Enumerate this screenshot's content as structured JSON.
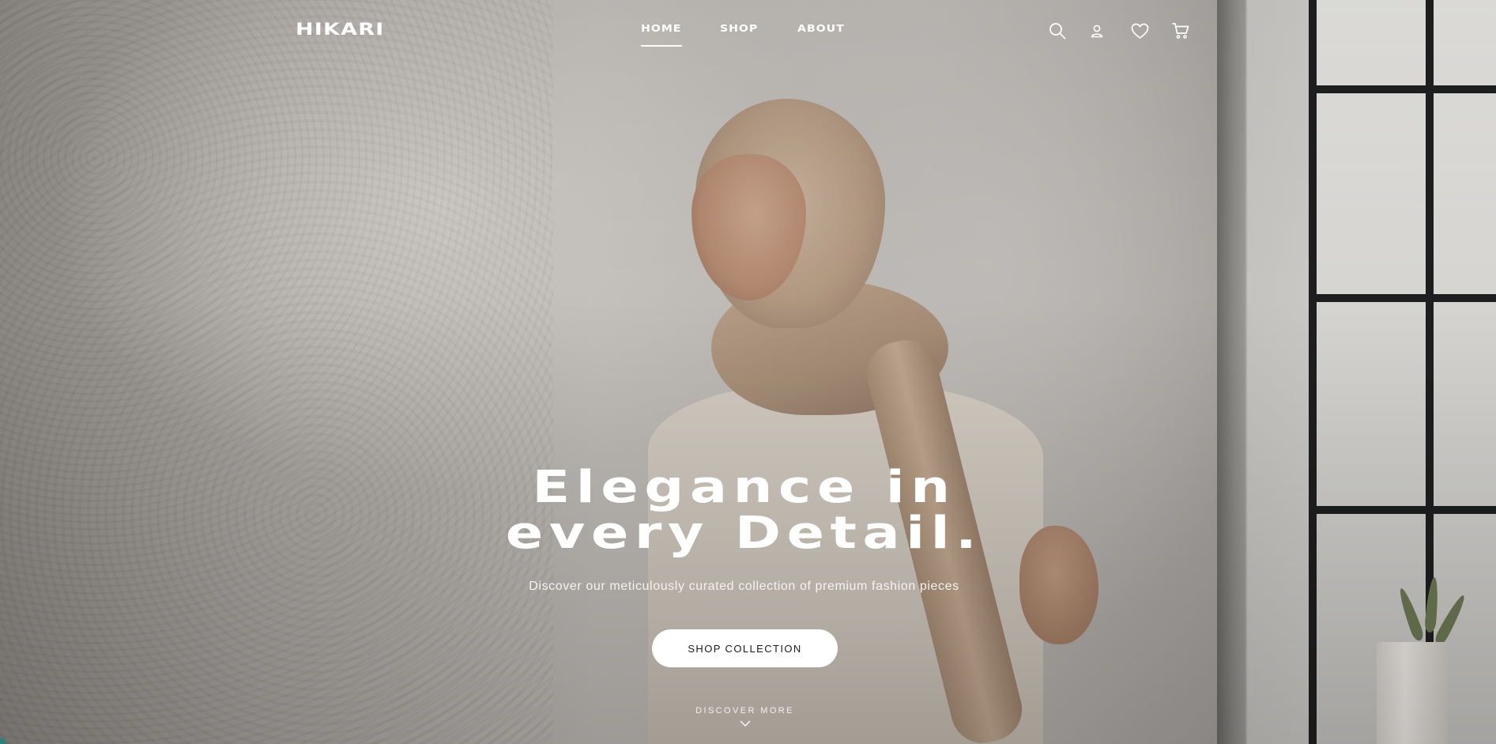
{
  "brand": {
    "logo": "HIKARI"
  },
  "nav": {
    "items": [
      {
        "label": "HOME",
        "active": true
      },
      {
        "label": "SHOP",
        "active": false
      },
      {
        "label": "ABOUT",
        "active": false
      }
    ]
  },
  "header_icons": [
    "search-icon",
    "user-icon",
    "heart-icon",
    "cart-icon"
  ],
  "hero": {
    "headline_line1": "Elegance in",
    "headline_line2": "every Detail.",
    "subtitle": "Discover our meticulously curated collection of premium fashion pieces",
    "cta_label": "SHOP COLLECTION",
    "discover_label": "DISCOVER MORE"
  },
  "colors": {
    "text": "#ffffff",
    "cta_background": "#ffffff",
    "cta_text": "#1b1b1b"
  }
}
